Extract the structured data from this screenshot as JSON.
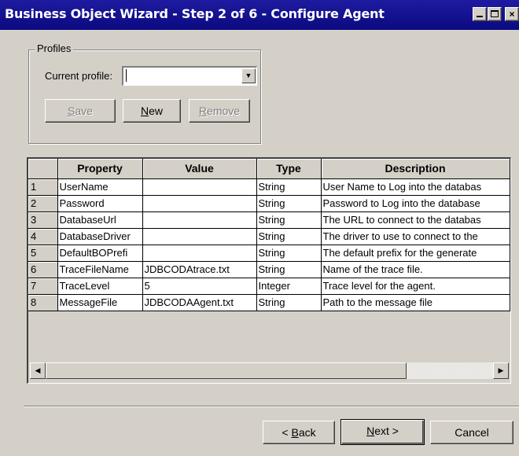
{
  "window": {
    "title": "Business Object Wizard - Step 2 of 6 - Configure Agent",
    "minimize_label": "_",
    "close_label": "×"
  },
  "profiles": {
    "group_label": "Profiles",
    "current_profile_label": "Current profile:",
    "current_profile_value": "",
    "dropdown_arrow": "▼",
    "save": {
      "pre": "",
      "ul": "S",
      "post": "ave"
    },
    "new": {
      "pre": "",
      "ul": "N",
      "post": "ew"
    },
    "remove": {
      "pre": "",
      "ul": "R",
      "post": "emove"
    }
  },
  "grid": {
    "columns": [
      "",
      "Property",
      "Value",
      "Type",
      "Description"
    ],
    "rows": [
      {
        "num": "1",
        "property": "UserName",
        "value": "",
        "type": "String",
        "description": "User Name to Log into the databas"
      },
      {
        "num": "2",
        "property": "Password",
        "value": "",
        "type": "String",
        "description": "Password to Log into the database"
      },
      {
        "num": "3",
        "property": "DatabaseUrl",
        "value": "",
        "type": "String",
        "description": "The URL to connect to the databas"
      },
      {
        "num": "4",
        "property": "DatabaseDriver",
        "value": "",
        "type": "String",
        "description": "The driver to use to connect to the"
      },
      {
        "num": "5",
        "property": "DefaultBOPrefi",
        "value": "",
        "type": "String",
        "description": "The default prefix for the generate"
      },
      {
        "num": "6",
        "property": "TraceFileName",
        "value": "JDBCODAtrace.txt",
        "type": "String",
        "description": "Name of the trace file."
      },
      {
        "num": "7",
        "property": "TraceLevel",
        "value": "5",
        "type": "Integer",
        "description": "Trace level for the agent."
      },
      {
        "num": "8",
        "property": "MessageFile",
        "value": "JDBCODAAgent.txt",
        "type": "String",
        "description": "Path to the message file"
      }
    ],
    "scroll_left": "◀",
    "scroll_right": "▶"
  },
  "footer": {
    "back": {
      "pre": "< ",
      "ul": "B",
      "post": "ack"
    },
    "next": {
      "pre": "",
      "ul": "N",
      "post": "ext >"
    },
    "cancel": "Cancel"
  }
}
